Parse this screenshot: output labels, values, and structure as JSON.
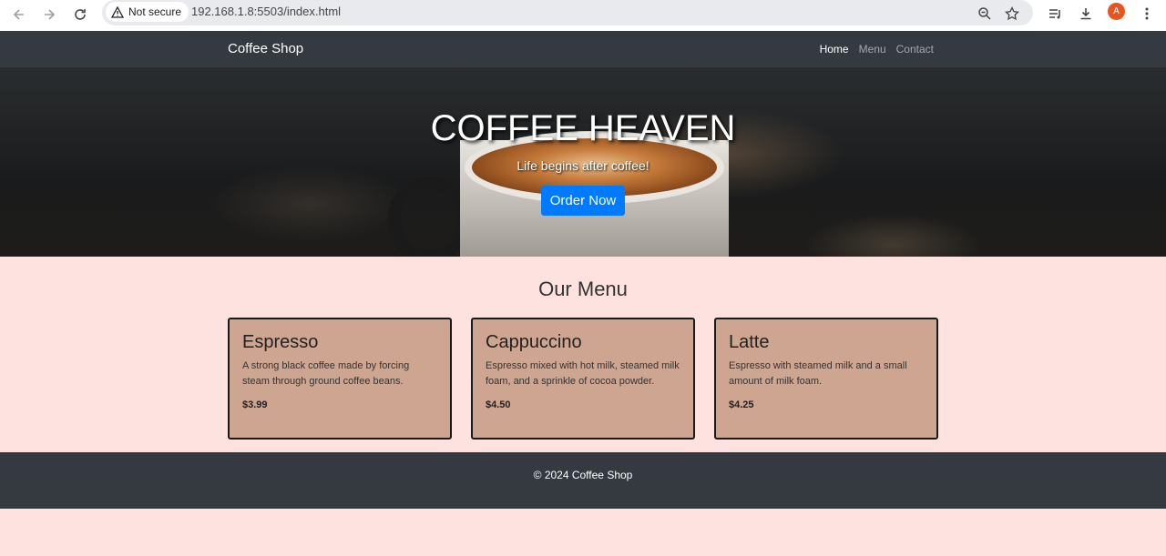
{
  "browser": {
    "security_label": "Not secure",
    "url": "192.168.1.8:5503/index.html",
    "profile_initial": "A"
  },
  "navbar": {
    "brand": "Coffee Shop",
    "links": [
      {
        "label": "Home",
        "active": true
      },
      {
        "label": "Menu",
        "active": false
      },
      {
        "label": "Contact",
        "active": false
      }
    ]
  },
  "hero": {
    "title": "COFFEE HEAVEN",
    "subtitle": "Life begins after coffee!",
    "button_label": "Order Now"
  },
  "menu": {
    "title": "Our Menu",
    "items": [
      {
        "name": "Espresso",
        "description": "A strong black coffee made by forcing steam through ground coffee beans.",
        "price": "$3.99"
      },
      {
        "name": "Cappuccino",
        "description": "Espresso mixed with hot milk, steamed milk foam, and a sprinkle of cocoa powder.",
        "price": "$4.50"
      },
      {
        "name": "Latte",
        "description": "Espresso with steamed milk and a small amount of milk foam.",
        "price": "$4.25"
      }
    ]
  },
  "footer": {
    "text": "© 2024 Coffee Shop"
  },
  "colors": {
    "navbar_bg": "#343a40",
    "page_bg": "#fde2df",
    "card_bg": "#cda591",
    "button_bg": "#007bff"
  }
}
